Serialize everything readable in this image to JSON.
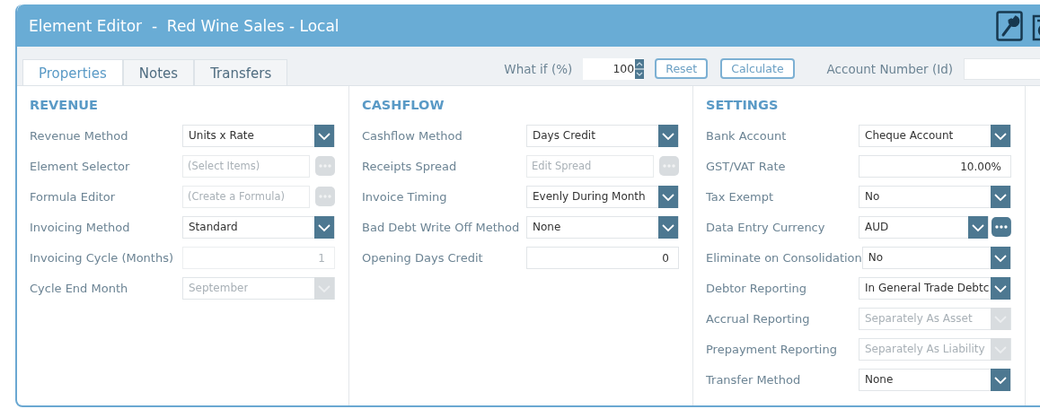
{
  "window": {
    "title": "Element Editor  -  Red Wine Sales - Local"
  },
  "tabs": [
    {
      "label": "Properties",
      "selected": true
    },
    {
      "label": "Notes",
      "selected": false
    },
    {
      "label": "Transfers",
      "selected": false
    }
  ],
  "toolbar": {
    "what_if_label": "What if (%)",
    "what_if_value": "100",
    "reset": "Reset",
    "calculate": "Calculate",
    "account_label": "Account Number (Id)"
  },
  "sections": [
    {
      "title": "REVENUE",
      "rows": [
        {
          "label": "Revenue Method",
          "kind": "select",
          "value": "Units x Rate",
          "disabled": false
        },
        {
          "label": "Element Selector",
          "kind": "picker",
          "placeholder": "(Select Items)",
          "disabled": true
        },
        {
          "label": "Formula Editor",
          "kind": "picker",
          "placeholder": "(Create a Formula)",
          "disabled": true
        },
        {
          "label": "Invoicing Method",
          "kind": "select",
          "value": "Standard",
          "disabled": false
        },
        {
          "label": "Invoicing Cycle (Months)",
          "kind": "number",
          "value": "1",
          "disabled": true
        },
        {
          "label": "Cycle End Month",
          "kind": "select",
          "value": "September",
          "disabled": true
        }
      ]
    },
    {
      "title": "CASHFLOW",
      "rows": [
        {
          "label": "Cashflow Method",
          "kind": "select",
          "value": "Days Credit",
          "disabled": false
        },
        {
          "label": "Receipts Spread",
          "kind": "picker",
          "placeholder": "Edit Spread",
          "disabled": true
        },
        {
          "label": "Invoice Timing",
          "kind": "select",
          "value": "Evenly During Month",
          "disabled": false
        },
        {
          "label": "Bad Debt Write Off Method",
          "kind": "select",
          "value": "None",
          "disabled": false
        },
        {
          "label": "Opening Days Credit",
          "kind": "number",
          "value": "0",
          "disabled": false
        }
      ]
    },
    {
      "title": "SETTINGS",
      "rows": [
        {
          "label": "Bank Account",
          "kind": "select",
          "value": "Cheque Account",
          "disabled": false
        },
        {
          "label": "GST/VAT Rate",
          "kind": "number",
          "value": "10.00%",
          "disabled": false
        },
        {
          "label": "Tax Exempt",
          "kind": "select",
          "value": "No",
          "disabled": false
        },
        {
          "label": "Data Entry Currency",
          "kind": "select_picker",
          "value": "AUD",
          "disabled": false
        },
        {
          "label": "Eliminate on Consolidation",
          "kind": "select",
          "value": "No",
          "disabled": false
        },
        {
          "label": "Debtor Reporting",
          "kind": "select",
          "value": "In General Trade Debtc",
          "disabled": false
        },
        {
          "label": "Accrual Reporting",
          "kind": "select",
          "value": "Separately As Asset",
          "disabled": true
        },
        {
          "label": "Prepayment Reporting",
          "kind": "select",
          "value": "Separately As Liability",
          "disabled": true
        },
        {
          "label": "Transfer Method",
          "kind": "select",
          "value": "None",
          "disabled": false
        }
      ]
    }
  ]
}
